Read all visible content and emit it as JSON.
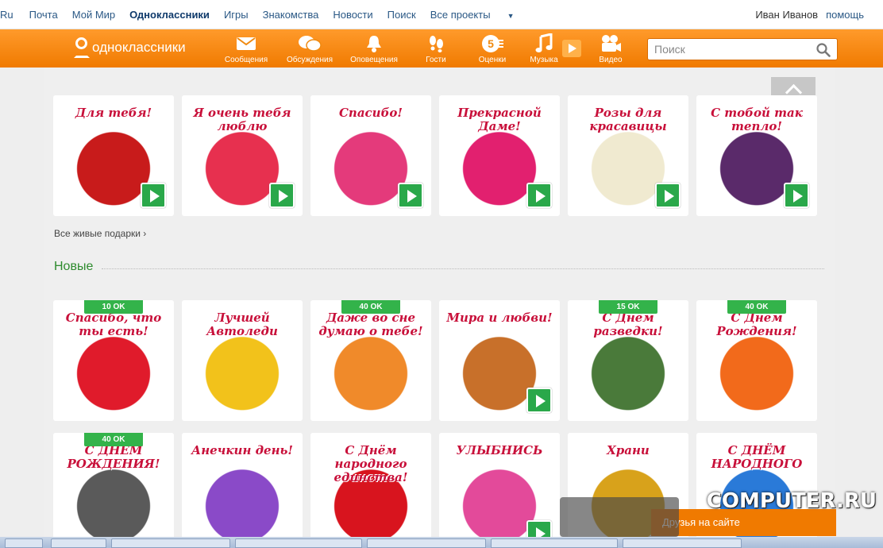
{
  "topbar": {
    "links": [
      "Ru",
      "Почта",
      "Мой Мир",
      "Одноклассники",
      "Игры",
      "Знакомства",
      "Новости",
      "Поиск",
      "Все проекты"
    ],
    "user": "Иван Иванов",
    "help": "помощь"
  },
  "header": {
    "logo": "одноклассники",
    "nav": [
      {
        "label": "Сообщения",
        "icon": "envelope-icon"
      },
      {
        "label": "Обсуждения",
        "icon": "chat-bubbles-icon"
      },
      {
        "label": "Оповещения",
        "icon": "bell-icon"
      },
      {
        "label": "Гости",
        "icon": "footprints-icon"
      },
      {
        "label": "Оценки",
        "icon": "rating-five-icon"
      },
      {
        "label": "Музыка",
        "icon": "music-note-icon"
      },
      {
        "label": "Видео",
        "icon": "video-camera-icon"
      }
    ],
    "search_placeholder": "Поиск"
  },
  "live_gifts": [
    {
      "caption": "Для тебя!",
      "bg": "#c81b1b"
    },
    {
      "caption": "Я очень тебя люблю",
      "bg": "#e7304f"
    },
    {
      "caption": "Спасибо!",
      "bg": "#e43a7b"
    },
    {
      "caption": "Прекрасной Даме!",
      "bg": "#e2206f"
    },
    {
      "caption": "Розы для красавицы",
      "bg": "#f0ead0"
    },
    {
      "caption": "С тобой так тепло!",
      "bg": "#5a2a6a"
    }
  ],
  "all_gifts_link": "Все живые подарки ›",
  "new_section_title": "Новые",
  "new_gifts_row1": [
    {
      "caption": "Спасибо, что ты есть!",
      "price": "10 OK",
      "bg": "#e01b2b"
    },
    {
      "caption": "Лучшей Автоледи",
      "price": "",
      "bg": "#f2c21b"
    },
    {
      "caption": "Даже во сне думаю о тебе!",
      "price": "40 OK",
      "bg": "#f08a2a"
    },
    {
      "caption": "Мира и любви!",
      "price": "",
      "bg": "#c8702a"
    },
    {
      "caption": "С Днём разведки!",
      "price": "15 OK",
      "bg": "#4a7a3a"
    },
    {
      "caption": "С Днём Рождения!",
      "price": "40 OK",
      "bg": "#f26a1b"
    }
  ],
  "new_gifts_row2": [
    {
      "caption": "С ДНЕМ РОЖДЕНИЯ!",
      "price": "40 OK",
      "bg": "#5a5a5a"
    },
    {
      "caption": "Анечкин день!",
      "price": "",
      "bg": "#8a4ac8"
    },
    {
      "caption": "С Днём народного единства!",
      "price": "",
      "bg": "#d8141e"
    },
    {
      "caption": "УЛЫБНИСЬ",
      "price": "",
      "bg": "#e34a9a"
    },
    {
      "caption": "Храни",
      "price": "",
      "bg": "#d8a21b"
    },
    {
      "caption": "С ДНЁМ НАРОДНОГО",
      "price": "",
      "bg": "#2a7ad8"
    }
  ],
  "friends_bar": "Друзья на сайте",
  "watermark": "COMPUTER.RU",
  "colors": {
    "orange": "#f07a00",
    "green": "#33b34a",
    "link": "#2a5885"
  }
}
